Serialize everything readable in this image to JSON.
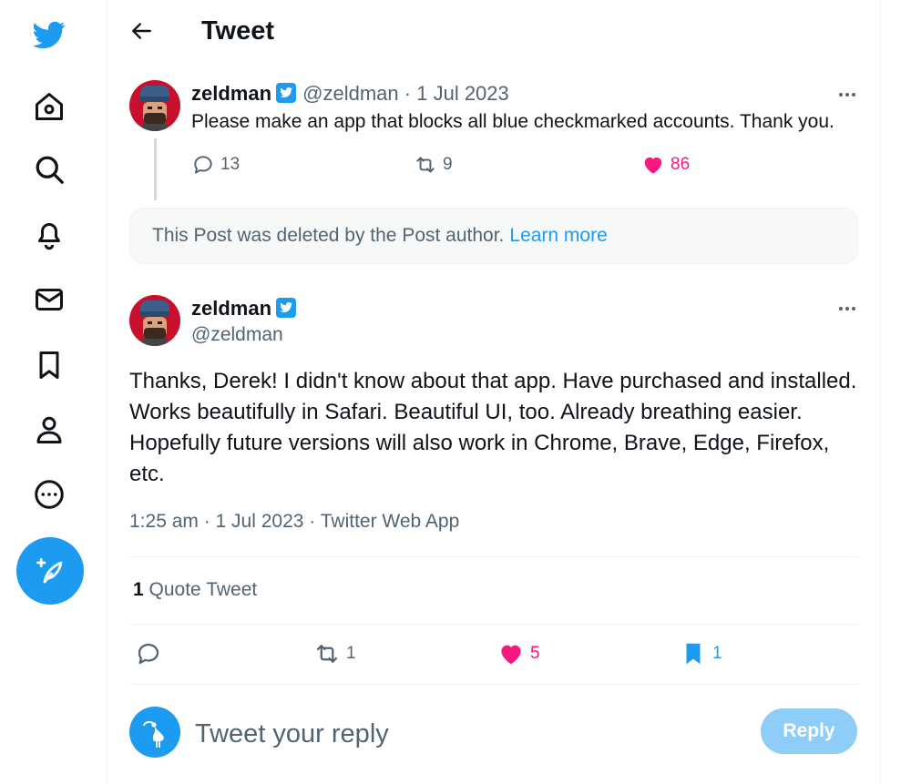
{
  "nav": {
    "icons": [
      "twitter-bird-icon",
      "home-icon",
      "search-icon",
      "bell-icon",
      "mail-icon",
      "bookmark-icon",
      "profile-icon",
      "more-circle-icon",
      "compose-icon"
    ]
  },
  "header": {
    "title": "Tweet"
  },
  "tweet1": {
    "name": "zeldman",
    "handle": "@zeldman",
    "separator": "·",
    "date": "1 Jul 2023",
    "text": "Please make an app that blocks all blue checkmarked accounts. Thank you.",
    "replies": "13",
    "retweets": "9",
    "likes": "86"
  },
  "deleted": {
    "text": "This Post was deleted by the Post author.",
    "link": "Learn more"
  },
  "tweet2": {
    "name": "zeldman",
    "handle": "@zeldman",
    "text": "Thanks, Derek! I didn't know about that app. Have purchased and installed. Works beautifully in Safari. Beautiful UI, too. Already breathing easier. Hopefully future versions will also work in Chrome, Brave, Edge, Firefox, etc.",
    "meta": "1:25 am · 1 Jul 2023 · Twitter Web App",
    "quote_count": "1",
    "quote_label": "Quote Tweet",
    "retweets": "1",
    "likes": "5",
    "bookmarks": "1"
  },
  "reply": {
    "placeholder": "Tweet your reply",
    "button": "Reply"
  },
  "colors": {
    "accent": "#1d9bf0",
    "like": "#f91880",
    "muted": "#536471"
  }
}
